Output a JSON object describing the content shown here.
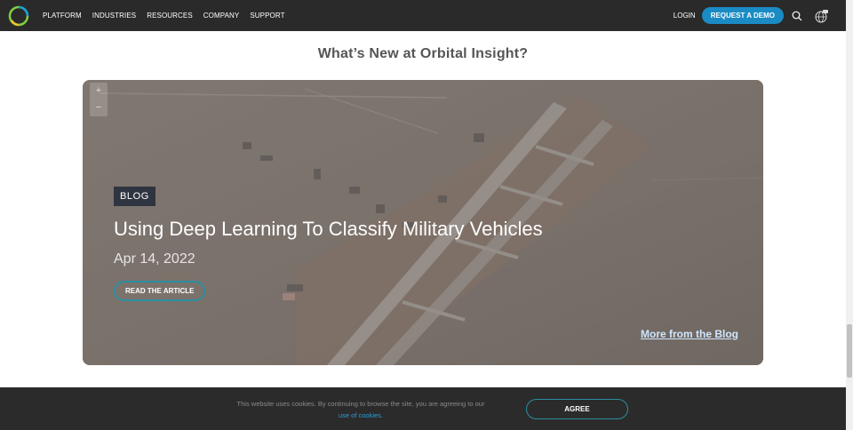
{
  "nav": {
    "items": [
      {
        "label": "PLATFORM"
      },
      {
        "label": "INDUSTRIES"
      },
      {
        "label": "RESOURCES"
      },
      {
        "label": "COMPANY"
      },
      {
        "label": "SUPPORT"
      }
    ],
    "login_label": "LOGIN",
    "demo_label": "REQUEST A DEMO",
    "icons": [
      "logo-icon",
      "search-icon",
      "globe-icon"
    ]
  },
  "section": {
    "heading": "What’s New at Orbital Insight?"
  },
  "feature": {
    "badge": "BLOG",
    "title": "Using Deep Learning To Classify Military Vehicles",
    "date": "Apr 14, 2022",
    "read_label": "READ THE ARTICLE",
    "more_label": "More from the Blog",
    "zoom_in": "+",
    "zoom_out": "−"
  },
  "cookie": {
    "text": "This website uses cookies. By continuing to browse the site, you are agreeing to our",
    "link_text": "use of cookies.",
    "agree_label": "AGREE"
  },
  "colors": {
    "nav_bg": "#2a2a2a",
    "accent": "#1b8bc4",
    "badge_bg": "#2f3540",
    "cookie_bg": "#2b2b2b"
  }
}
